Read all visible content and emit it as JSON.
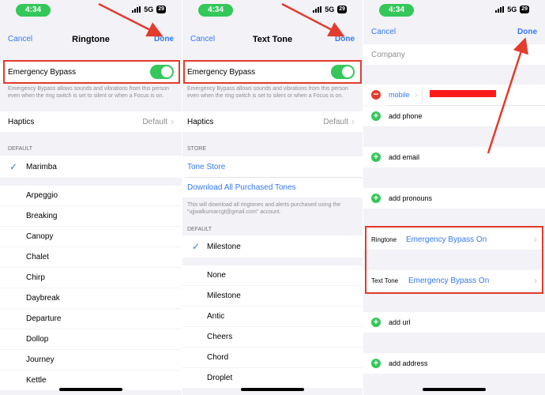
{
  "colors": {
    "accent": "#3478f6",
    "toggle_on": "#34c759",
    "highlight": "#e33b2c",
    "redaction": "#ff1a1a"
  },
  "status": {
    "time": "4:34",
    "network": "5G",
    "battery": "29"
  },
  "ringtone_screen": {
    "cancel": "Cancel",
    "title": "Ringtone",
    "done": "Done",
    "bypass_label": "Emergency Bypass",
    "bypass_desc": "Emergency Bypass allows sounds and vibrations from this person even when the ring switch is set to silent or when a Focus is on.",
    "haptics_label": "Haptics",
    "haptics_value": "Default",
    "default_header": "DEFAULT",
    "selected_tone": "Marimba",
    "tones": [
      "Arpeggio",
      "Breaking",
      "Canopy",
      "Chalet",
      "Chirp",
      "Daybreak",
      "Departure",
      "Dollop",
      "Journey",
      "Kettle"
    ]
  },
  "texttone_screen": {
    "cancel": "Cancel",
    "title": "Text Tone",
    "done": "Done",
    "bypass_label": "Emergency Bypass",
    "bypass_desc": "Emergency Bypass allows sounds and vibrations from this person even when the ring switch is set to silent or when a Focus is on.",
    "haptics_label": "Haptics",
    "haptics_value": "Default",
    "store_header": "STORE",
    "tone_store": "Tone Store",
    "download_all": "Download All Purchased Tones",
    "download_desc": "This will download all ringtones and alerts purchased using the \"ujjwalkumarcgt@gmail.com\" account.",
    "default_header": "DEFAULT",
    "selected_tone": "Milestone",
    "tones": [
      "None",
      "Milestone",
      "Antic",
      "Cheers",
      "Chord",
      "Droplet"
    ]
  },
  "contact_screen": {
    "cancel": "Cancel",
    "done": "Done",
    "company_placeholder": "Company",
    "mobile_label": "mobile",
    "add_phone": "add phone",
    "add_email": "add email",
    "add_pronouns": "add pronouns",
    "ringtone_label": "Ringtone",
    "ringtone_value": "Emergency Bypass On",
    "texttone_label": "Text Tone",
    "texttone_value": "Emergency Bypass On",
    "add_url": "add url",
    "add_address": "add address"
  }
}
